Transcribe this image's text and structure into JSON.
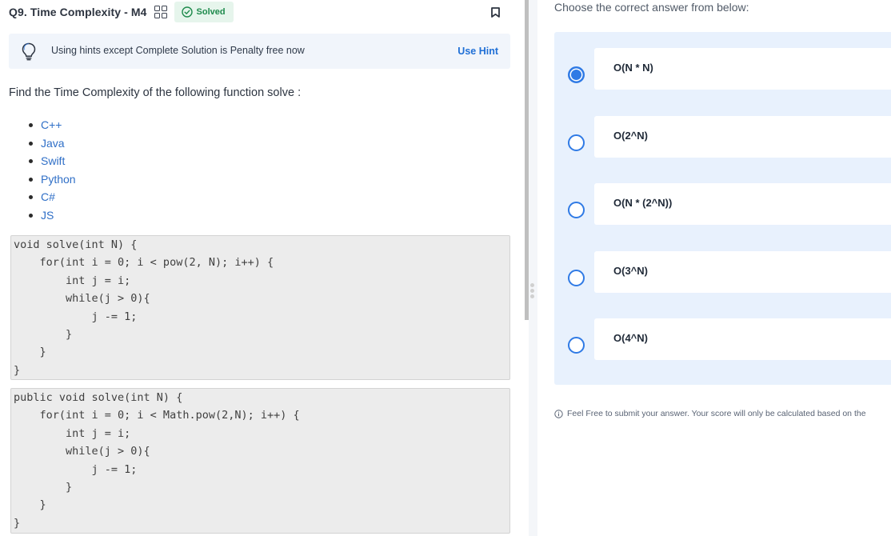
{
  "question": {
    "title": "Q9. Time Complexity - M4",
    "status_badge": "Solved"
  },
  "hint": {
    "text": "Using hints except Complete Solution is Penalty free now",
    "button": "Use Hint"
  },
  "prompt": "Find the Time Complexity of the following function solve :",
  "languages": [
    "C++",
    "Java",
    "Swift",
    "Python",
    "C#",
    "JS"
  ],
  "code_blocks": [
    "void solve(int N) {\n    for(int i = 0; i < pow(2, N); i++) {\n        int j = i;\n        while(j > 0){\n            j -= 1;\n        }\n    }\n}",
    "public void solve(int N) {\n    for(int i = 0; i < Math.pow(2,N); i++) {\n        int j = i;\n        while(j > 0){\n            j -= 1;\n        }\n    }\n}"
  ],
  "answer_panel": {
    "heading": "Choose the correct answer from below:",
    "options": [
      {
        "label": "O(N * N)",
        "selected": true
      },
      {
        "label": "O(2^N)",
        "selected": false
      },
      {
        "label": "O(N * (2^N))",
        "selected": false
      },
      {
        "label": "O(3^N)",
        "selected": false
      },
      {
        "label": "O(4^N)",
        "selected": false
      }
    ],
    "note": "Feel Free to submit your answer. Your score will only be calculated based on the"
  },
  "colors": {
    "accent": "#2f7ae5",
    "solved_green": "#1e8a4c",
    "options_bg": "#e8f1fd",
    "link_blue": "#1f6fd6"
  }
}
